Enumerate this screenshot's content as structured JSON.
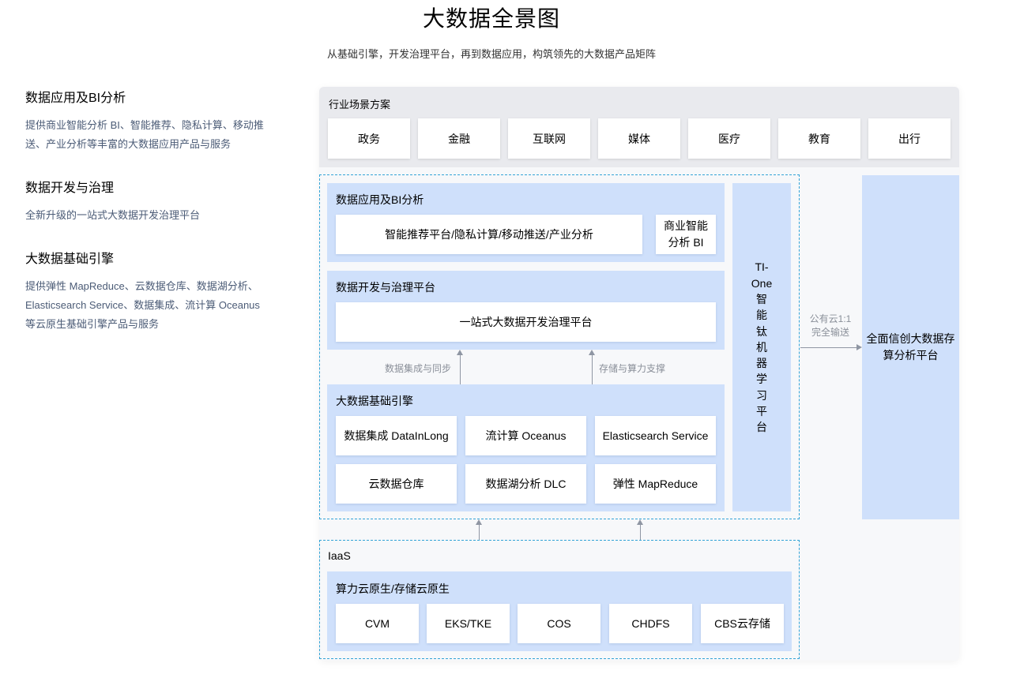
{
  "title": "大数据全景图",
  "subtitle": "从基础引擎，开发治理平台，再到数据应用，构筑领先的大数据产品矩阵",
  "left": [
    {
      "heading": "数据应用及BI分析",
      "desc_lines": [
        "提供商业智能分析 BI、智能推荐、隐私计算、移动推",
        "送、产业分析等丰富的大数据应用产品与服务"
      ]
    },
    {
      "heading": "数据开发与治理",
      "desc_lines": [
        "全新升级的一站式大数据开发治理平台"
      ]
    },
    {
      "heading": "大数据基础引擎",
      "desc_lines": [
        "提供弹性 MapReduce、云数据仓库、数据湖分析、",
        "Elasticsearch Service、数据集成、流计算 Oceanus",
        "等云原生基础引擎产品与服务"
      ]
    }
  ],
  "industry": {
    "label": "行业场景方案",
    "items": [
      "政务",
      "金融",
      "互联网",
      "媒体",
      "医疗",
      "教育",
      "出行"
    ]
  },
  "bi_section": {
    "label": "数据应用及BI分析",
    "main_box": "智能推荐平台/隐私计算/移动推送/产业分析",
    "bi_box_lines": [
      "商业智能",
      "分析 BI"
    ]
  },
  "dev_section": {
    "label": "数据开发与治理平台",
    "box": "一站式大数据开发治理平台"
  },
  "arrows": {
    "left_label": "数据集成与同步",
    "right_label": "存储与算力支撑"
  },
  "engine_section": {
    "label": "大数据基础引擎",
    "items": [
      "数据集成 DataInLong",
      "流计算 Oceanus",
      "Elasticsearch Service",
      "云数据仓库",
      "数据湖分析 DLC",
      "弹性 MapReduce"
    ]
  },
  "tione_lines": [
    "TI-",
    "One",
    "智",
    "能",
    "钛",
    "机",
    "器",
    "学",
    "习",
    "平",
    "台"
  ],
  "transfer_note_lines": [
    "公有云1:1",
    "完全输送"
  ],
  "right_platform_lines": [
    "全面信创大数据存",
    "算分析平台"
  ],
  "iaas": {
    "label": "IaaS",
    "section_label": "算力云原生/存储云原生",
    "items": [
      "CVM",
      "EKS/TKE",
      "COS",
      "CHDFS",
      "CBS云存储"
    ]
  }
}
